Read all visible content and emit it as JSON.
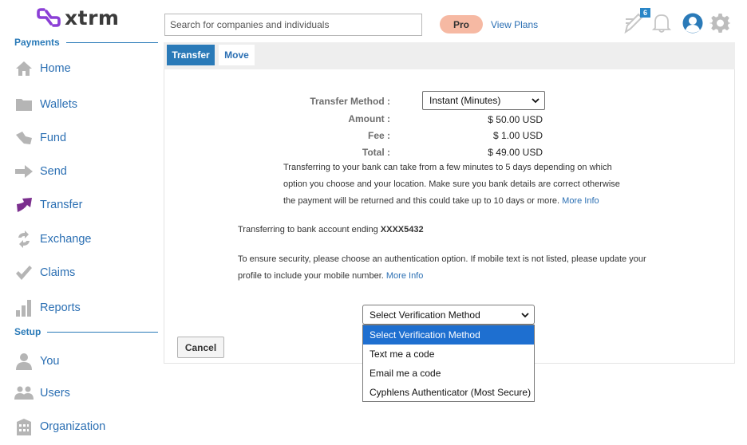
{
  "app": {
    "name": "xtrm"
  },
  "sidebar": {
    "sections": [
      {
        "title": "Payments"
      },
      {
        "title": "Setup"
      }
    ],
    "items": [
      {
        "label": "Home",
        "icon": "home-icon"
      },
      {
        "label": "Wallets",
        "icon": "folder-icon"
      },
      {
        "label": "Fund",
        "icon": "fund-icon"
      },
      {
        "label": "Send",
        "icon": "arrow-right-icon"
      },
      {
        "label": "Transfer",
        "icon": "transfer-arrow-icon",
        "active": true
      },
      {
        "label": "Exchange",
        "icon": "exchange-icon"
      },
      {
        "label": "Claims",
        "icon": "checkmark-icon"
      },
      {
        "label": "Reports",
        "icon": "bar-chart-icon"
      },
      {
        "label": "You",
        "icon": "person-icon"
      },
      {
        "label": "Users",
        "icon": "users-icon"
      },
      {
        "label": "Organization",
        "icon": "building-icon"
      }
    ]
  },
  "header": {
    "search_placeholder": "Search for companies and individuals",
    "pro_label": "Pro",
    "view_plans": "View Plans",
    "notification_count": "6"
  },
  "tabs": [
    {
      "label": "Transfer",
      "active": true
    },
    {
      "label": "Move",
      "active": false
    }
  ],
  "transfer": {
    "method_label": "Transfer Method :",
    "method_value": "Instant (Minutes)",
    "amount_label": "Amount :",
    "amount_value": "$ 50.00 USD",
    "fee_label": "Fee :",
    "fee_value": "$ 1.00 USD",
    "total_label": "Total :",
    "total_value": "$ 49.00 USD",
    "info_line1": "Transferring to your bank can take from a few minutes to 5 days depending on which",
    "info_line2": "option you choose and your location. Make sure you bank details are correct otherwise",
    "info_line3": "the payment will be returned and this could take up to 10 days or more.",
    "info_more": "More Info",
    "account_prefix": "Transferring to bank account ending",
    "account_number": "XXXX5432",
    "security_line1": "To ensure security, please choose an authentication option. If mobile text is not listed, please update your",
    "security_line2": "profile to include your mobile number.",
    "security_more": "More Info"
  },
  "verification": {
    "selected": "Select Verification Method",
    "options": [
      "Select Verification Method",
      "Text me a code",
      "Email me a code",
      "Cyphlens Authenticator (Most Secure)"
    ]
  },
  "buttons": {
    "cancel": "Cancel"
  },
  "colors": {
    "brand_purple": "#8b3fd6",
    "link_blue": "#2b6fb3",
    "tab_active": "#2a7ab8",
    "pro_badge": "#f6b9a3",
    "option_highlight": "#1e6fd0"
  }
}
